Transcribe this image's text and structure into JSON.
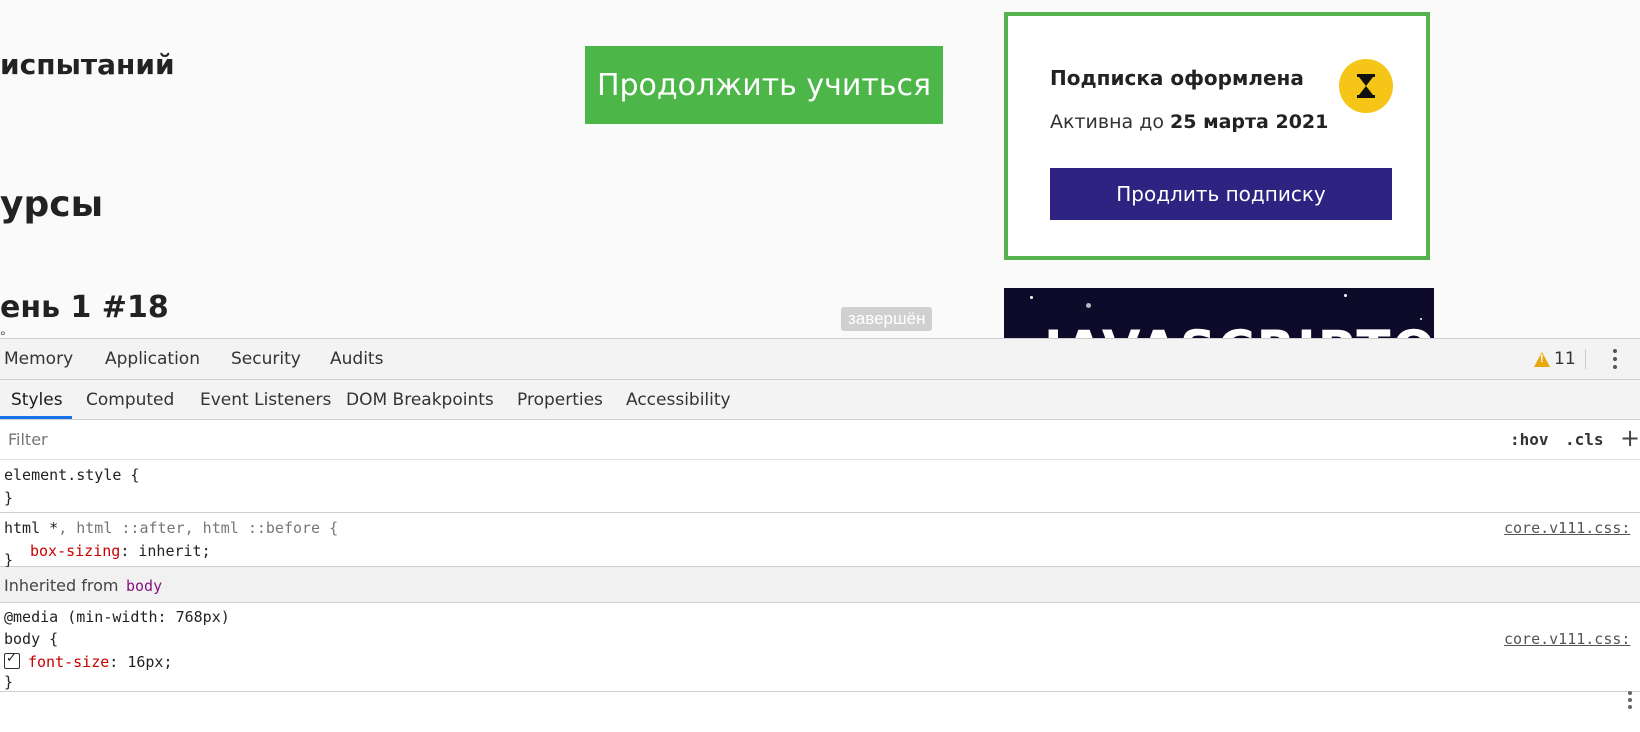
{
  "page": {
    "heading_1": "испытаний",
    "heading_2": "урсы",
    "heading_3": "ень 1 #18",
    "subtext": "°",
    "continue_label": "Продолжить учиться",
    "status_badge": "завершён"
  },
  "subscription": {
    "title": "Подписка оформлена",
    "active_prefix": "Активна до",
    "active_date": "25 марта 2021",
    "renew_label": "Продлить подписку",
    "icon": "hourglass-icon"
  },
  "promo": {
    "text": "JAVASCRIPTON"
  },
  "devtools": {
    "tabs": [
      "Memory",
      "Application",
      "Security",
      "Audits"
    ],
    "warning_count": "11",
    "subtabs": [
      "Styles",
      "Computed",
      "Event Listeners",
      "DOM Breakpoints",
      "Properties",
      "Accessibility"
    ],
    "active_subtab": "Styles",
    "filter_placeholder": "Filter",
    "hov": ":hov",
    "cls": ".cls",
    "plus": "+",
    "rules": {
      "element_style": {
        "selector": "element.style {",
        "close": "}"
      },
      "universal": {
        "selector_main": "html *",
        "selector_rest": ", html ::after, html ::before {",
        "property": "box-sizing",
        "value": ": inherit;",
        "close": "}",
        "source": "core.v111.css:"
      },
      "inherited_label": "Inherited from",
      "inherited_element": "body",
      "media_rule": {
        "media": "@media (min-width: 768px)",
        "selector": "body {",
        "property": "font-size",
        "value": ": 16px;",
        "close": "}",
        "source": "core.v111.css:"
      }
    }
  },
  "colors": {
    "continue_green": "#4cb648",
    "card_border": "#55b24d",
    "renew_purple": "#2e2381",
    "hourglass_yellow": "#f5c518",
    "devtools_accent": "#1a73e8"
  }
}
